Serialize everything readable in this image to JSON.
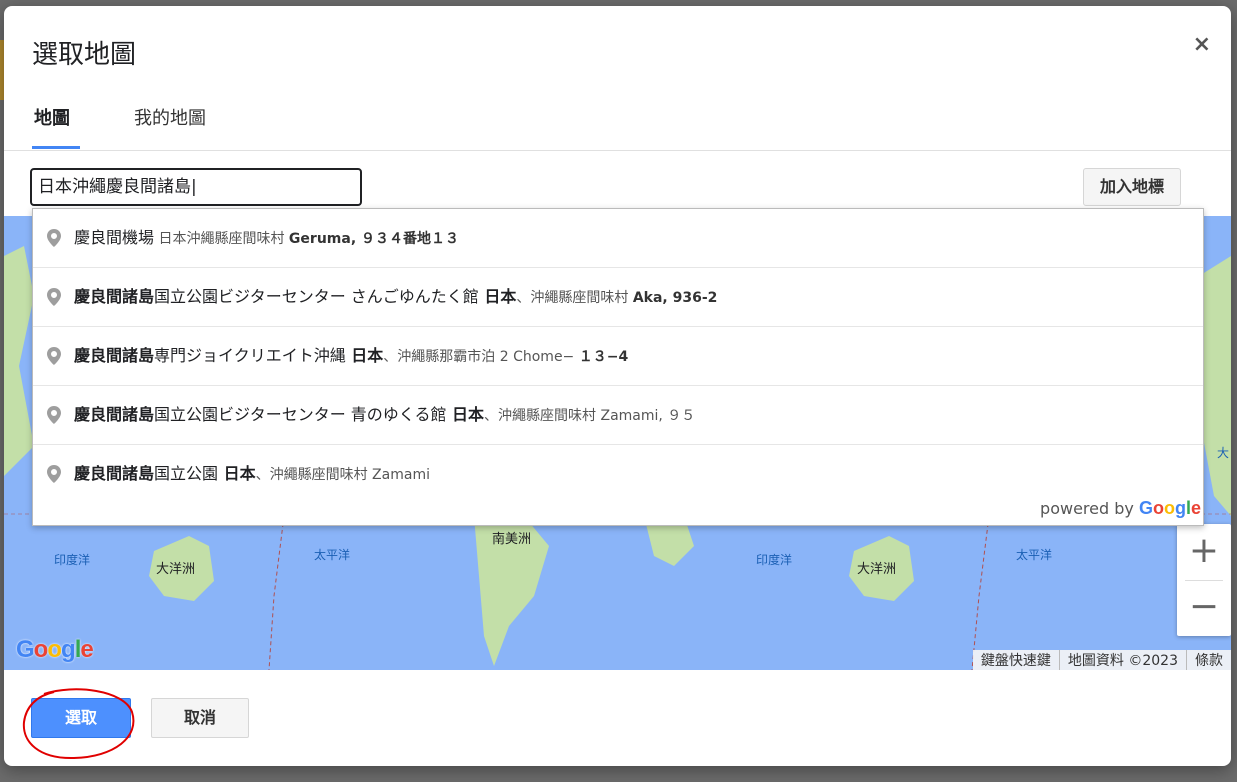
{
  "dialog": {
    "title": "選取地圖",
    "close_symbol": "×"
  },
  "tabs": [
    {
      "label": "地圖",
      "active": true
    },
    {
      "label": "我的地圖",
      "active": false
    }
  ],
  "search": {
    "value": "日本沖繩慶良間諸島"
  },
  "add_marker_label": "加入地標",
  "suggestions": [
    {
      "bold": "",
      "main": "慶良間機場",
      "sec_pre": " 日本沖繩縣座間味村 ",
      "sec_bold": "Geruma, ９３４番地１３"
    },
    {
      "bold": "慶良間諸島",
      "main": "国立公園ビジターセンター さんごゆんたく館",
      "sec_pre": " 日本",
      "sec_mid": "、沖繩縣座間味村 ",
      "sec_bold": "Aka, 936-2"
    },
    {
      "bold": "慶良間諸島",
      "main": "専門ジョイクリエイト沖縄",
      "sec_pre": " 日本",
      "sec_mid": "、沖繩縣那霸市泊 2 Chome− ",
      "sec_bold": "１３−4"
    },
    {
      "bold": "慶良間諸島",
      "main": "国立公園ビジターセンター 青のゆくる館",
      "sec_pre": " 日本",
      "sec_mid": "、沖繩縣座間味村 Zamami, ９５",
      "sec_bold": ""
    },
    {
      "bold": "慶良間諸島",
      "main": "国立公園",
      "sec_pre": " 日本",
      "sec_mid": "、沖繩縣座間味村 Zamami",
      "sec_bold": ""
    }
  ],
  "powered_by": {
    "text": "powered by ",
    "brand": "Google"
  },
  "map": {
    "labels": {
      "indian_ocean_1": "印度洋",
      "oceania_1": "大洋洲",
      "pacific_1": "太平洋",
      "south_america": "南美洲",
      "indian_ocean_2": "印度洋",
      "oceania_2": "大洋洲",
      "pacific_2": "太平洋",
      "edge_label": "大"
    },
    "zoom_in": "+",
    "zoom_out": "−",
    "logo": "Google",
    "attribution": {
      "shortcuts": "鍵盤快速鍵",
      "data": "地圖資料 ©2023",
      "terms": "條款"
    }
  },
  "buttons": {
    "select": "選取",
    "cancel": "取消"
  },
  "colors": {
    "water": "#8ab4f8",
    "land": "#c3dfa8",
    "primary_button": "#4d90fe",
    "annotation": "#e00000"
  }
}
